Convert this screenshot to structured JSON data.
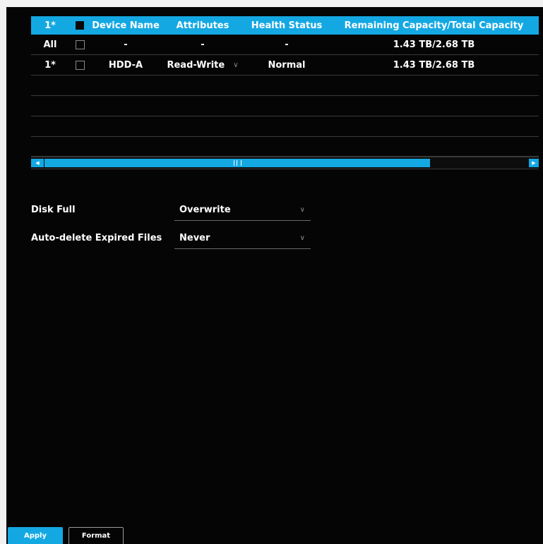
{
  "table": {
    "headers": {
      "index": "1*",
      "device_name": "Device Name",
      "attributes": "Attributes",
      "health_status": "Health Status",
      "capacity": "Remaining Capacity/Total Capacity"
    },
    "rows": [
      {
        "index": "All",
        "checked": false,
        "device_name": "-",
        "attributes": "-",
        "health_status": "-",
        "capacity": "1.43 TB/2.68 TB"
      },
      {
        "index": "1*",
        "checked": false,
        "device_name": "HDD-A",
        "attributes": "Read-Write",
        "health_status": "Normal",
        "capacity": "1.43 TB/2.68 TB"
      }
    ],
    "scroll_left_glyph": "◀",
    "scroll_right_glyph": "▶"
  },
  "settings": {
    "disk_full": {
      "label": "Disk Full",
      "value": "Overwrite"
    },
    "auto_delete": {
      "label": "Auto-delete Expired Files",
      "value": "Never"
    },
    "chevron_glyph": "∨"
  },
  "buttons": {
    "apply": "Apply",
    "format": "Format"
  },
  "colors": {
    "accent": "#14a8e3",
    "background": "#050505"
  }
}
